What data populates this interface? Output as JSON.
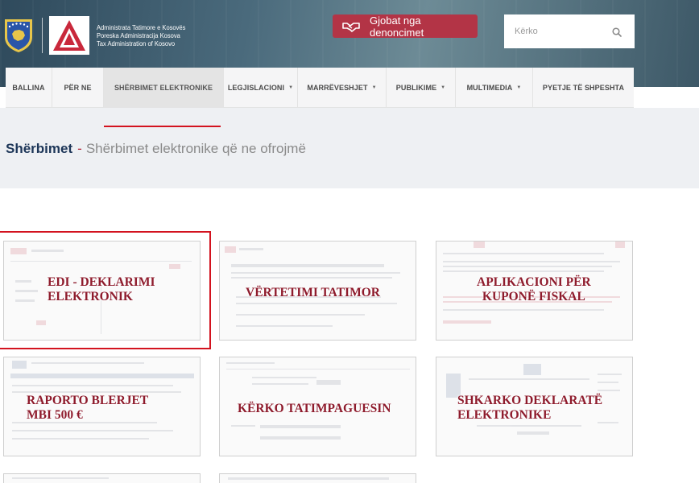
{
  "org": {
    "line1": "Administrata Tatimore e Kosovës",
    "line2": "Poreska Administracija Kosova",
    "line3": "Tax Administration of Kosovo"
  },
  "header": {
    "gjobat_label": "Gjobat nga denoncimet",
    "search_placeholder": "Kërko"
  },
  "nav": {
    "items": [
      {
        "label": "BALLINA",
        "dropdown": false,
        "active": false
      },
      {
        "label": "PËR NE",
        "dropdown": false,
        "active": false
      },
      {
        "label": "SHËRBIMET ELEKTRONIKE",
        "dropdown": false,
        "active": true
      },
      {
        "label": "LEGJISLACIONI",
        "dropdown": true,
        "active": false
      },
      {
        "label": "MARRËVESHJET",
        "dropdown": true,
        "active": false
      },
      {
        "label": "PUBLIKIME",
        "dropdown": true,
        "active": false
      },
      {
        "label": "MULTIMEDIA",
        "dropdown": true,
        "active": false
      },
      {
        "label": "PYETJE TË SHPESHTA",
        "dropdown": false,
        "active": false
      }
    ]
  },
  "page": {
    "title_bold": "Shërbimet",
    "separator": "-",
    "subtitle": "Shërbimet elektronike që ne ofrojmë"
  },
  "services": [
    {
      "line1": "EDI - DEKLARIMI",
      "line2": "ELEKTRONIK"
    },
    {
      "line1": "VËRTETIMI TATIMOR",
      "line2": ""
    },
    {
      "line1": "APLIKACIONI PËR",
      "line2": "KUPONË FISKAL"
    },
    {
      "line1": "RAPORTO BLERJET",
      "line2": "MBI 500 €"
    },
    {
      "line1": "KËRKO TATIMPAGUESIN",
      "line2": ""
    },
    {
      "line1": "SHKARKO DEKLARATË",
      "line2": "ELEKTRONIKE"
    }
  ],
  "colors": {
    "accent_red": "#d3131f",
    "card_label": "#8e1b2c",
    "gjobat_bg": "#b33446",
    "title_blue": "#1d3658"
  }
}
